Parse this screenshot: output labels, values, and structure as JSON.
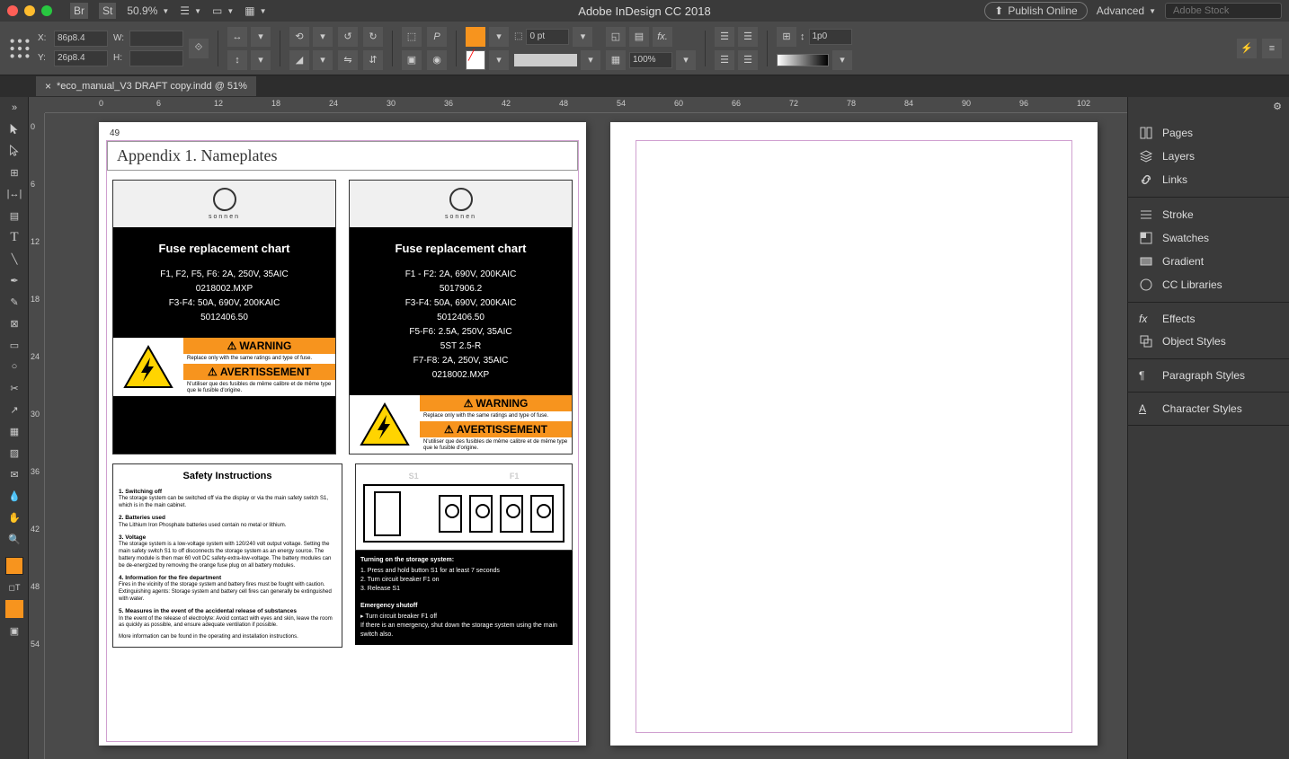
{
  "app": {
    "title": "Adobe InDesign CC 2018"
  },
  "menu": {
    "bridge": "Br",
    "stock": "St",
    "zoom": "50.9%",
    "publish": "Publish Online",
    "workspace": "Advanced",
    "search_placeholder": "Adobe Stock"
  },
  "control": {
    "x": "86p8.4",
    "y": "26p8.4",
    "w": "",
    "h": "",
    "stroke": "0 pt",
    "scale": "100%",
    "ref": "1p0"
  },
  "tab": {
    "name": "*eco_manual_V3 DRAFT copy.indd @ 51%"
  },
  "ruler_h": [
    "0",
    "6",
    "12",
    "18",
    "24",
    "30",
    "36",
    "42",
    "48",
    "54",
    "60",
    "66",
    "72",
    "78",
    "84",
    "90",
    "96",
    "102"
  ],
  "ruler_v": [
    "0",
    "6",
    "12",
    "18",
    "24",
    "30",
    "36",
    "42",
    "48",
    "54"
  ],
  "page": {
    "number": "49",
    "heading": "Appendix 1.  Nameplates",
    "brand": "sonnen",
    "nameplate1": {
      "title": "Fuse replacement chart",
      "lines": [
        "F1, F2, F5, F6: 2A, 250V, 35AIC",
        "0218002.MXP",
        "F3-F4: 50A, 690V, 200KAIC",
        "5012406.50"
      ]
    },
    "nameplate2": {
      "title": "Fuse replacement chart",
      "lines": [
        "F1 - F2: 2A, 690V, 200KAIC",
        "5017906.2",
        "F3-F4: 50A, 690V, 200KAIC",
        "5012406.50",
        "F5-F6: 2.5A, 250V, 35AIC",
        "5ST 2.5-R",
        "F7-F8: 2A, 250V, 35AIC",
        "0218002.MXP"
      ]
    },
    "warning": {
      "label": "WARNING",
      "text1": "Replace only with the same ratings and type of fuse.",
      "label2": "AVERTISSEMENT",
      "text2": "N'utiliser que des fusibles de même calibre et de même type que le fusible d'origine."
    },
    "safety": {
      "title": "Safety Instructions",
      "sec1_h": "1. Switching off",
      "sec1_t": "The storage system can be switched off via the display or via the main safety switch S1, which is in the main cabinet.",
      "sec2_h": "2. Batteries used",
      "sec2_t": "The Lithium Iron Phosphate batteries used contain no metal or lithium.",
      "sec3_h": "3. Voltage",
      "sec3_t": "The storage system is a low-voltage system with 120/240 volt output voltage. Setting the main safety switch S1 to off disconnects the storage system as an energy source. The battery module is then max 60 volt DC safety-extra-low-voltage. The battery modules can be de-energized by removing the orange fuse plug on all battery modules.",
      "sec4_h": "4. Information for the fire department",
      "sec4_t": "Fires in the vicinity of the storage system and battery fires must be fought with caution. Extinguishing agents: Storage system and battery cell fires can generally be extinguished with water.",
      "sec5_h": "5. Measures in the event of the accidental release of substances",
      "sec5_t": "In the event of the release of electrolyte: Avoid contact with eyes and skin, leave the room as quickly as possible, and ensure adequate ventilation if possible.",
      "foot": "More information can be found in the operating and installation instructions."
    },
    "diagram": {
      "s1": "S1",
      "f1": "F1",
      "inst_title": "Turning on the storage system:",
      "inst1": "1. Press and hold button S1 for at least 7 seconds",
      "inst2": "2. Turn circuit breaker F1 on",
      "inst3": "3. Release S1",
      "emerg": "Emergency shutoff",
      "emerg1": "▸ Turn circuit breaker F1 off",
      "emerg2": "If there is an emergency, shut down the storage system using the main switch also."
    }
  },
  "panels": {
    "g1": [
      "Pages",
      "Layers",
      "Links"
    ],
    "g2": [
      "Stroke",
      "Swatches",
      "Gradient",
      "CC Libraries"
    ],
    "g3": [
      "Effects",
      "Object Styles"
    ],
    "g4": [
      "Paragraph Styles"
    ],
    "g5": [
      "Character Styles"
    ]
  }
}
